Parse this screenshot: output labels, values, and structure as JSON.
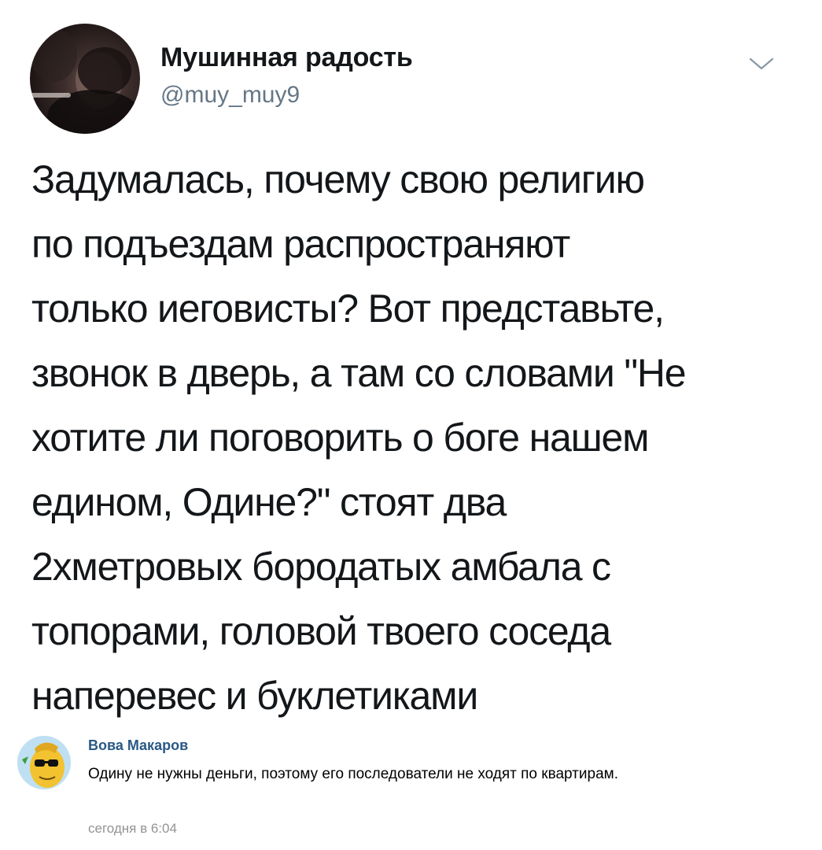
{
  "tweet": {
    "author_name": "Мушинная радость",
    "author_handle": "@muy_muy9",
    "text": "Задумалась, почему свою религию\nпо подъездам распространяют\nтолько иеговисты? Вот представьте,\nзвонок в дверь, а там со словами \"Не\nхотите ли поговорить о боге нашем\nедином, Одине?\" стоят два\n2хметровых бородатых амбала с\nтопорами, головой твоего соседа\nнаперевес и буклетиками",
    "menu_icon": "chevron-down-icon"
  },
  "comment": {
    "author_name": "Вова Макаров",
    "text": "Одину не нужны деньги, поэтому его последователи не ходят по квартирам.",
    "time": "сегодня в 6:04"
  },
  "colors": {
    "text": "#14171a",
    "handle": "#657786",
    "comment_author": "#2a5885",
    "comment_time": "#939393"
  }
}
